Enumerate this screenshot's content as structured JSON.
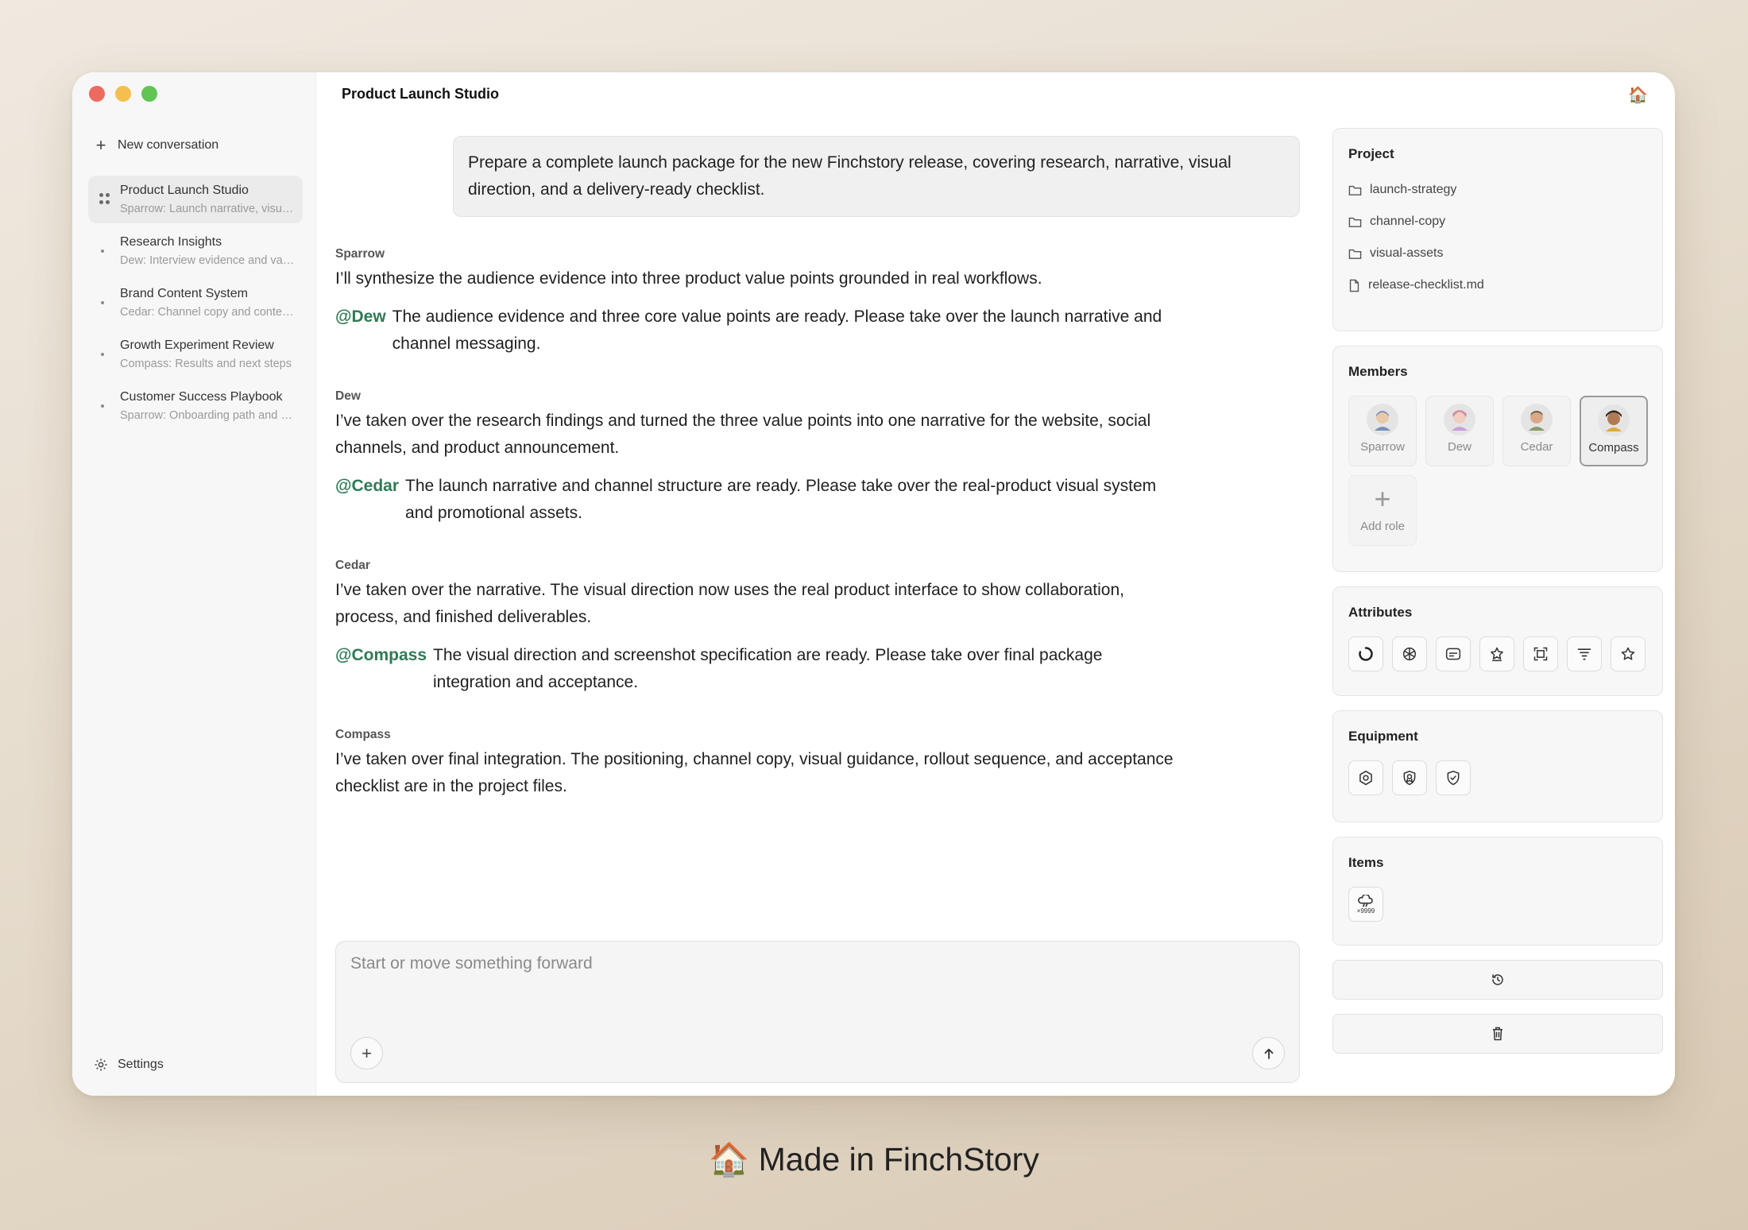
{
  "window": {
    "title": "Product Launch Studio"
  },
  "sidebar": {
    "new_conversation": "New conversation",
    "conversations": [
      {
        "title": "Product Launch Studio",
        "subtitle": "Sparrow: Launch narrative, visual direction",
        "active": true
      },
      {
        "title": "Research Insights",
        "subtitle": "Dew: Interview evidence and value points",
        "active": false
      },
      {
        "title": "Brand Content System",
        "subtitle": "Cedar: Channel copy and content guide",
        "active": false
      },
      {
        "title": "Growth Experiment Review",
        "subtitle": "Compass: Results and next steps",
        "active": false
      },
      {
        "title": "Customer Success Playbook",
        "subtitle": "Sparrow: Onboarding path and scripts",
        "active": false
      }
    ],
    "settings": "Settings"
  },
  "chat": {
    "user_message": "Prepare a complete launch package for the new Finchstory release, covering research, narrative, visual direction, and a delivery-ready checklist.",
    "messages": [
      {
        "author": "Sparrow",
        "text": "I’ll synthesize the audience evidence into three product value points grounded in real workflows.",
        "mention": "@Dew",
        "handoff": "The audience evidence and three core value points are ready. Please take over the launch narrative and channel messaging."
      },
      {
        "author": "Dew",
        "text": "I’ve taken over the research findings and turned the three value points into one narrative for the website, social channels, and product announcement.",
        "mention": "@Cedar",
        "handoff": "The launch narrative and channel structure are ready. Please take over the real-product visual system and promotional assets."
      },
      {
        "author": "Cedar",
        "text": "I’ve taken over the narrative. The visual direction now uses the real product interface to show collaboration, process, and finished deliverables.",
        "mention": "@Compass",
        "handoff": "The visual direction and screenshot specification are ready. Please take over final package integration and acceptance."
      },
      {
        "author": "Compass",
        "text": "I’ve taken over final integration. The positioning, channel copy, visual guidance, rollout sequence, and acceptance checklist are in the project files."
      }
    ]
  },
  "composer": {
    "placeholder": "Start or move something forward"
  },
  "panel": {
    "project": {
      "title": "Project",
      "files": [
        {
          "name": "launch-strategy",
          "icon": "folder-icon"
        },
        {
          "name": "channel-copy",
          "icon": "folder-icon"
        },
        {
          "name": "visual-assets",
          "icon": "folder-icon"
        },
        {
          "name": "release-checklist.md",
          "icon": "file-icon"
        }
      ]
    },
    "members": {
      "title": "Members",
      "list": [
        {
          "name": "Sparrow",
          "color": "#7a8fb8"
        },
        {
          "name": "Dew",
          "color": "#d68aa3"
        },
        {
          "name": "Cedar",
          "color": "#8a9a6a"
        },
        {
          "name": "Compass",
          "color": "#5a4634",
          "selected": true
        }
      ],
      "add_label": "Add role"
    },
    "attributes": {
      "title": "Attributes",
      "icons": [
        "loader-icon",
        "openai-icon",
        "caption-icon",
        "star-badge-icon",
        "scan-icon",
        "filter-icon",
        "star-icon"
      ]
    },
    "equipment": {
      "title": "Equipment",
      "icons": [
        "hexagon-shield-icon",
        "shield-badge-icon",
        "shield-check-icon"
      ]
    },
    "items": {
      "title": "Items",
      "item_count": "×9999"
    }
  },
  "footer": {
    "made_in": "Made in FinchStory"
  }
}
